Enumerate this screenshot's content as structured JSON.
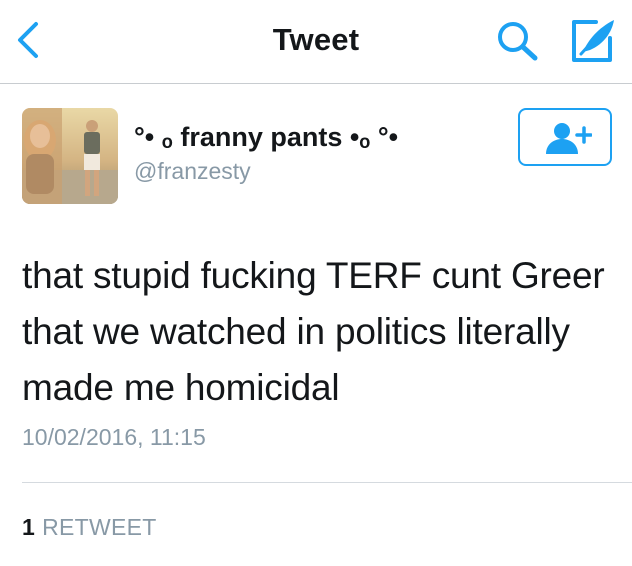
{
  "header": {
    "title": "Tweet",
    "back_icon": "chevron-left-icon",
    "search_icon": "search-icon",
    "compose_icon": "compose-tweet-icon"
  },
  "tweet": {
    "author": {
      "display_name": "°• ﻿ₒ franny pants •ₒ °•",
      "handle": "@franzesty"
    },
    "follow_icon": "follow-user-icon",
    "text": "that stupid fucking TERF cunt Greer that we watched in politics literally made me homicidal",
    "timestamp": "10/02/2016, 11:15",
    "retweet_count": "1",
    "retweet_label": "RETWEET"
  },
  "colors": {
    "accent": "#1da1f2",
    "text_primary": "#14171a",
    "text_secondary": "#8899a6"
  }
}
